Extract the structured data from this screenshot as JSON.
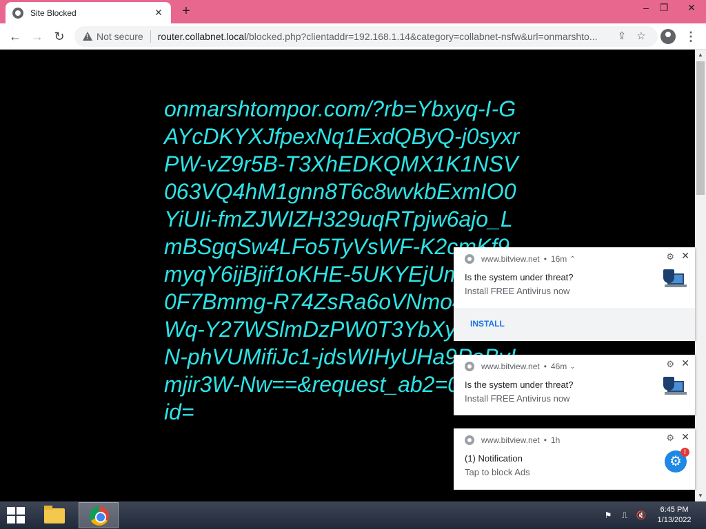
{
  "browser": {
    "tab_title": "Site Blocked",
    "tab_close": "✕",
    "new_tab": "+",
    "window_min": "–",
    "window_max": "❐",
    "window_close": "✕",
    "nav_back": "←",
    "nav_forward": "→",
    "nav_reload": "↻",
    "security_label": "Not secure",
    "url_host": "router.collabnet.local",
    "url_path": "/blocked.php?clientaddr=192.168.1.14&category=collabnet-nsfw&url=onmarshto...",
    "share": "⇪",
    "star": "☆",
    "menu": "⋮"
  },
  "page": {
    "blocked_url_text": "onmarshtompor.com/?rb=Ybxyq-I-GAYcDKYXJfpexNq1ExdQByQ-j0syxrPW-vZ9r5B-T3XhEDKQMX1K1NSV063VQ4hM1gnn8T6c8wvkbExmIO0YiUIi-fmZJWIZH329uqRTpjw6ajo_LmBSgqSw4LFo5TyVsWF-K2cmKf9myqY6ijBjif1oKHE-5UKYEjUmXRi_J0F7Bmmg-R74ZsRa6oVNmo4lmGWq-Y27WSlmDzPW0T3YbXyAxYQN-phVUMifiJc1-jdsWIHyUHa9PoBvImjir3W-Nw==&request_ab2=0&zoneid="
  },
  "notifications": [
    {
      "site": "www.bitview.net",
      "time": "16m",
      "chevron": "⌃",
      "title": "Is the system under threat?",
      "body": "Install FREE Antivirus now",
      "action": "INSTALL"
    },
    {
      "site": "www.bitview.net",
      "time": "46m",
      "chevron": "⌄",
      "title": "Is the system under threat?",
      "body": "Install FREE Antivirus now"
    },
    {
      "site": "www.bitview.net",
      "time": "1h",
      "title": "(1) Notification",
      "body": "Tap to block Ads",
      "badge": "!"
    }
  ],
  "notification_dot": "•",
  "notification_gear": "⚙",
  "notification_close": "✕",
  "scrollbar": {
    "up": "▲",
    "down": "▼"
  },
  "taskbar": {
    "time": "6:45 PM",
    "date": "1/13/2022",
    "tray_flag": "⚑",
    "tray_network": "⎍",
    "tray_volume": "🔇"
  },
  "colors": {
    "titlebar": "#e8678f",
    "blocked_text": "#2ee3e6",
    "page_background": "#000000",
    "install_button": "#1a73e8"
  }
}
